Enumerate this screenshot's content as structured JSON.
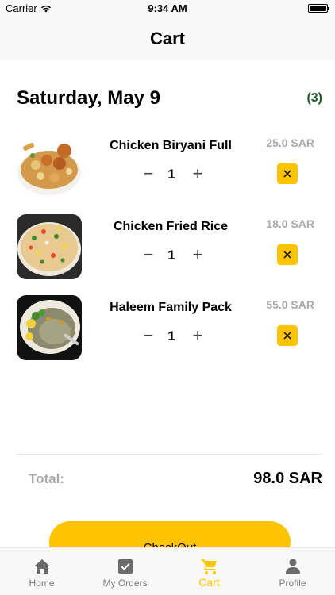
{
  "status_bar": {
    "carrier": "Carrier",
    "time": "9:34 AM"
  },
  "nav": {
    "title": "Cart"
  },
  "cart": {
    "date": "Saturday, May 9",
    "count_label": "(3)",
    "items": [
      {
        "name": "Chicken Biryani Full",
        "quantity": "1",
        "price": "25.0 SAR",
        "image": "chicken-biryani-photo"
      },
      {
        "name": "Chicken Fried Rice",
        "quantity": "1",
        "price": "18.0 SAR",
        "image": "chicken-fried-rice-photo"
      },
      {
        "name": "Haleem Family Pack",
        "quantity": "1",
        "price": "55.0 SAR",
        "image": "haleem-photo"
      }
    ],
    "total_label": "Total:",
    "total_value": "98.0 SAR",
    "checkout_label": "CheckOut"
  },
  "tab_bar": {
    "tabs": [
      {
        "label": "Home",
        "icon": "home-icon"
      },
      {
        "label": "My Orders",
        "icon": "checkbox-icon"
      },
      {
        "label": "Cart",
        "icon": "cart-icon"
      },
      {
        "label": "Profile",
        "icon": "person-icon"
      }
    ],
    "active": "Cart"
  },
  "colors": {
    "accent": "#ffc400",
    "count_badge": "#1e5c2a",
    "price_gray": "#a9a9a9",
    "tab_inactive": "#7c7c7c",
    "bar_background": "#f8f8f8"
  }
}
